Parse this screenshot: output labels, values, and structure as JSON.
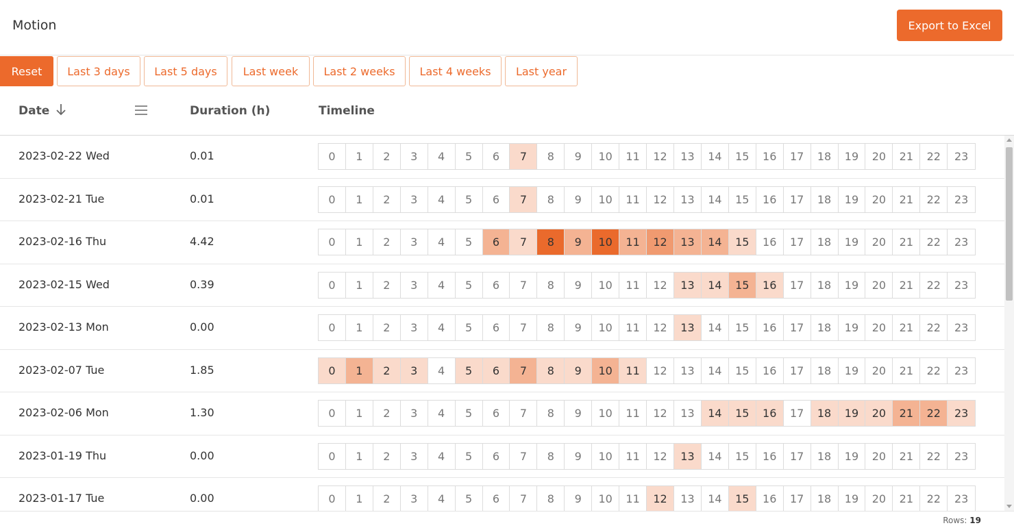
{
  "header": {
    "title": "Motion",
    "export_label": "Export to Excel"
  },
  "filters": [
    {
      "label": "Reset",
      "active": true
    },
    {
      "label": "Last 3 days",
      "active": false
    },
    {
      "label": "Last 5 days",
      "active": false
    },
    {
      "label": "Last week",
      "active": false
    },
    {
      "label": "Last 2 weeks",
      "active": false
    },
    {
      "label": "Last 4 weeks",
      "active": false
    },
    {
      "label": "Last year",
      "active": false
    }
  ],
  "table": {
    "columns": {
      "date": "Date",
      "duration": "Duration (h)",
      "timeline": "Timeline"
    },
    "sort_icon": "arrow-down-icon",
    "menu_icon": "hamburger-menu-icon",
    "hours": [
      "0",
      "1",
      "2",
      "3",
      "4",
      "5",
      "6",
      "7",
      "8",
      "9",
      "10",
      "11",
      "12",
      "13",
      "14",
      "15",
      "16",
      "17",
      "18",
      "19",
      "20",
      "21",
      "22",
      "23"
    ],
    "rows": [
      {
        "date": "2023-02-22 Wed",
        "duration": "0.01",
        "activity": [
          0,
          0,
          0,
          0,
          0,
          0,
          0,
          1,
          0,
          0,
          0,
          0,
          0,
          0,
          0,
          0,
          0,
          0,
          0,
          0,
          0,
          0,
          0,
          0
        ]
      },
      {
        "date": "2023-02-21 Tue",
        "duration": "0.01",
        "activity": [
          0,
          0,
          0,
          0,
          0,
          0,
          0,
          1,
          0,
          0,
          0,
          0,
          0,
          0,
          0,
          0,
          0,
          0,
          0,
          0,
          0,
          0,
          0,
          0
        ]
      },
      {
        "date": "2023-02-16 Thu",
        "duration": "4.42",
        "activity": [
          0,
          0,
          0,
          0,
          0,
          0,
          2,
          1,
          5,
          2,
          5,
          2,
          3,
          2,
          2,
          1,
          0,
          0,
          0,
          0,
          0,
          0,
          0,
          0
        ]
      },
      {
        "date": "2023-02-15 Wed",
        "duration": "0.39",
        "activity": [
          0,
          0,
          0,
          0,
          0,
          0,
          0,
          0,
          0,
          0,
          0,
          0,
          0,
          1,
          1,
          2,
          1,
          0,
          0,
          0,
          0,
          0,
          0,
          0
        ]
      },
      {
        "date": "2023-02-13 Mon",
        "duration": "0.00",
        "activity": [
          0,
          0,
          0,
          0,
          0,
          0,
          0,
          0,
          0,
          0,
          0,
          0,
          0,
          1,
          0,
          0,
          0,
          0,
          0,
          0,
          0,
          0,
          0,
          0
        ]
      },
      {
        "date": "2023-02-07 Tue",
        "duration": "1.85",
        "activity": [
          1,
          2,
          1,
          1,
          0,
          1,
          1,
          2,
          1,
          1,
          2,
          1,
          0,
          0,
          0,
          0,
          0,
          0,
          0,
          0,
          0,
          0,
          0,
          0
        ]
      },
      {
        "date": "2023-02-06 Mon",
        "duration": "1.30",
        "activity": [
          0,
          0,
          0,
          0,
          0,
          0,
          0,
          0,
          0,
          0,
          0,
          0,
          0,
          0,
          1,
          1,
          1,
          0,
          1,
          1,
          1,
          2,
          2,
          1
        ]
      },
      {
        "date": "2023-01-19 Thu",
        "duration": "0.00",
        "activity": [
          0,
          0,
          0,
          0,
          0,
          0,
          0,
          0,
          0,
          0,
          0,
          0,
          0,
          1,
          0,
          0,
          0,
          0,
          0,
          0,
          0,
          0,
          0,
          0
        ]
      },
      {
        "date": "2023-01-17 Tue",
        "duration": "0.00",
        "activity": [
          0,
          0,
          0,
          0,
          0,
          0,
          0,
          0,
          0,
          0,
          0,
          0,
          1,
          0,
          0,
          1,
          0,
          0,
          0,
          0,
          0,
          0,
          0,
          0
        ]
      }
    ]
  },
  "footer": {
    "rows_label": "Rows:",
    "rows_value": "19"
  },
  "colors": {
    "accent": "#ec6a2c",
    "level_1": "#fadacb",
    "level_2": "#f4b393",
    "level_3": "#f09a70",
    "level_5": "#ea6a2c"
  }
}
